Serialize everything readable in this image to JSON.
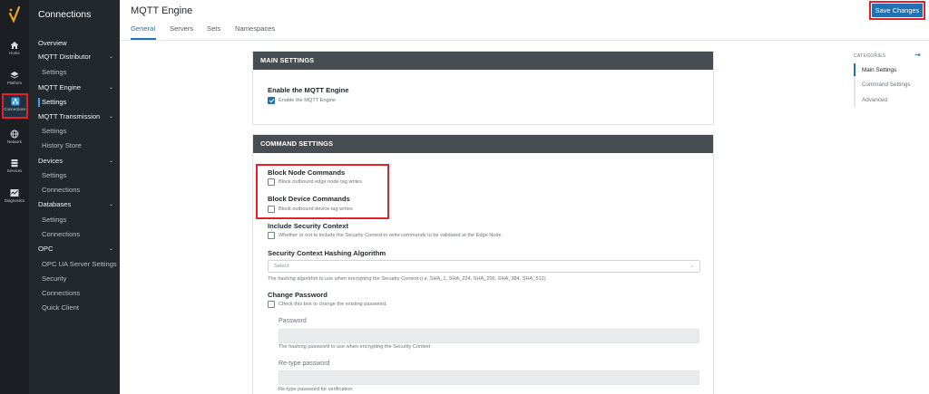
{
  "rail": {
    "items": [
      {
        "label": "Home",
        "icon": "home-icon"
      },
      {
        "label": "Platform",
        "icon": "layers-icon"
      },
      {
        "label": "Connections",
        "icon": "connections-icon"
      },
      {
        "label": "Network",
        "icon": "globe-icon"
      },
      {
        "label": "Services",
        "icon": "server-icon"
      },
      {
        "label": "Diagnostics",
        "icon": "diagnostics-icon"
      }
    ]
  },
  "nav": {
    "title": "Connections",
    "items": [
      {
        "label": "Overview",
        "kind": "group"
      },
      {
        "label": "MQTT Distributor",
        "kind": "group",
        "chevron": "⌄"
      },
      {
        "label": "Settings",
        "kind": "sub"
      },
      {
        "label": "MQTT Engine",
        "kind": "group",
        "chevron": "⌄"
      },
      {
        "label": "Settings",
        "kind": "sub",
        "selected": true
      },
      {
        "label": "MQTT Transmission",
        "kind": "group",
        "chevron": "⌄"
      },
      {
        "label": "Settings",
        "kind": "sub"
      },
      {
        "label": "History Store",
        "kind": "sub"
      },
      {
        "label": "Devices",
        "kind": "group",
        "chevron": "⌄"
      },
      {
        "label": "Settings",
        "kind": "sub"
      },
      {
        "label": "Connections",
        "kind": "sub"
      },
      {
        "label": "Databases",
        "kind": "group",
        "chevron": "⌄"
      },
      {
        "label": "Settings",
        "kind": "sub"
      },
      {
        "label": "Connections",
        "kind": "sub"
      },
      {
        "label": "OPC",
        "kind": "group",
        "chevron": "⌄"
      },
      {
        "label": "OPC UA Server Settings",
        "kind": "sub"
      },
      {
        "label": "Security",
        "kind": "sub"
      },
      {
        "label": "Connections",
        "kind": "sub"
      },
      {
        "label": "Quick Client",
        "kind": "sub"
      }
    ]
  },
  "header": {
    "title": "MQTT Engine",
    "save_label": "Save Changes",
    "tabs": [
      "General",
      "Servers",
      "Sets",
      "Namespaces"
    ]
  },
  "main_settings": {
    "heading": "MAIN SETTINGS",
    "enable_label": "Enable the MQTT Engine",
    "enable_checkbox_label": "Enable the MQTT Engine",
    "enabled": true
  },
  "command_settings": {
    "heading": "COMMAND SETTINGS",
    "block_node_label": "Block Node Commands",
    "block_node_hint": "Block outbound edge node tag writes",
    "block_device_label": "Block Device Commands",
    "block_device_hint": "Block outbound device tag writes",
    "include_security_label": "Include Security Context",
    "include_security_hint": "Whether or not to include the Security Context in write commands to be validated at the Edge Node",
    "hashing_label": "Security Context Hashing Algorithm",
    "hashing_placeholder": "Select",
    "hashing_hint": "The hashing algorithm to use when encrypting the Security Context (i.e. SHA_1, SHA_224, SHA_256, SHA_384, SHA_512).",
    "change_password_label": "Change Password",
    "change_password_hint": "Check this box to change the existing password.",
    "password_label": "Password",
    "password_hint": "The hashing password to use when encrypting the Security Context",
    "retype_label": "Re-type password",
    "retype_hint": "Re-type password for verification"
  },
  "categories": {
    "title": "CATEGORIES",
    "items": [
      "Main Settings",
      "Command Settings",
      "Advanced"
    ]
  },
  "colors": {
    "accent": "#1f72b3",
    "highlight_red": "#e5202b",
    "card_header": "#474d53"
  }
}
